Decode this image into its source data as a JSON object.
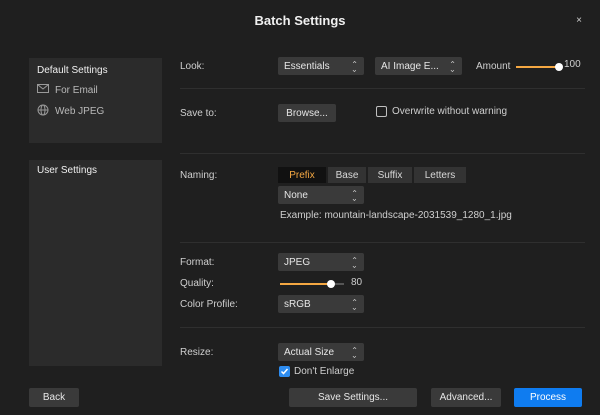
{
  "window": {
    "title": "Batch Settings",
    "close_glyph": "×"
  },
  "sidebar": {
    "default_title": "Default Settings",
    "default_items": [
      {
        "label": "For Email",
        "icon": "mail-icon"
      },
      {
        "label": "Web JPEG",
        "icon": "globe-icon"
      }
    ],
    "user_title": "User Settings"
  },
  "look": {
    "label": "Look:",
    "style_select": "Essentials",
    "ai_select": "AI Image E...",
    "amount_label": "Amount",
    "amount_value": "100",
    "amount_fraction": 1.0
  },
  "save": {
    "label": "Save to:",
    "browse_button": "Browse...",
    "overwrite_label": "Overwrite without warning",
    "overwrite_checked": false
  },
  "naming": {
    "label": "Naming:",
    "tabs": [
      "Prefix",
      "Base",
      "Suffix",
      "Letters"
    ],
    "active_tab": "Prefix",
    "select_value": "None",
    "example": "Example: mountain-landscape-2031539_1280_1.jpg"
  },
  "format": {
    "format_label": "Format:",
    "format_value": "JPEG",
    "quality_label": "Quality:",
    "quality_value": "80",
    "quality_fraction": 0.8,
    "profile_label": "Color Profile:",
    "profile_value": "sRGB"
  },
  "resize": {
    "label": "Resize:",
    "value": "Actual Size",
    "dont_enlarge_label": "Don't Enlarge",
    "dont_enlarge_checked": true
  },
  "footer": {
    "back": "Back",
    "save_settings": "Save Settings...",
    "advanced": "Advanced...",
    "process": "Process"
  },
  "colors": {
    "accent": "#f4a742",
    "primary": "#0f7cf0",
    "background": "#1f1f1f",
    "panel": "#2b2b2b"
  }
}
